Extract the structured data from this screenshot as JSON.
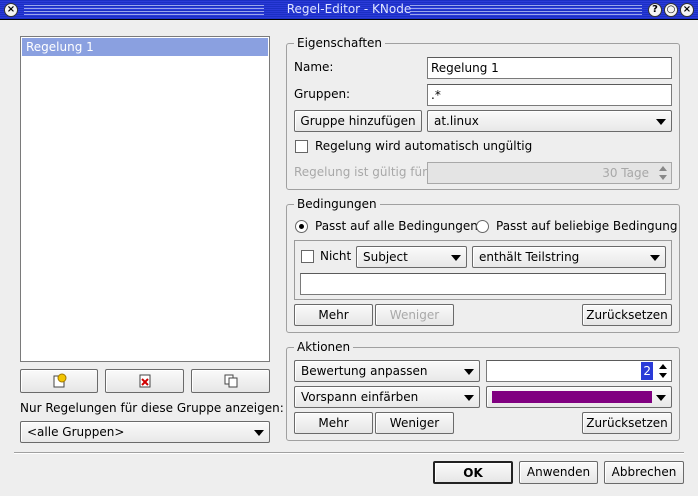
{
  "window": {
    "title": "Regel-Editor - KNode"
  },
  "rules_list": {
    "items": [
      "Regelung 1"
    ]
  },
  "list_buttons": {
    "new_icon": "new-rule-icon",
    "delete_icon": "delete-rule-icon",
    "copy_icon": "copy-rule-icon"
  },
  "group_filter": {
    "label": "Nur Regelungen für diese Gruppe anzeigen:",
    "value": "<alle Gruppen>"
  },
  "properties": {
    "title": "Eigenschaften",
    "name_label": "Name:",
    "name_value": "Regelung 1",
    "groups_label": "Gruppen:",
    "groups_value": ".*",
    "add_group_button": "Gruppe hinzufügen",
    "group_combo": "at.linux",
    "expires_checkbox_label": "Regelung wird automatisch ungültig",
    "valid_for_label": "Regelung ist gültig für:",
    "valid_for_value": "30 Tage"
  },
  "conditions": {
    "title": "Bedingungen",
    "radio_all": "Passt auf alle Bedingungen",
    "radio_any": "Passt auf beliebige Bedingung",
    "not_label": "Nicht",
    "field_combo": "Subject",
    "match_combo": "enthält Teilstring",
    "value": "",
    "more_button": "Mehr",
    "less_button": "Weniger",
    "reset_button": "Zurücksetzen"
  },
  "actions": {
    "title": "Aktionen",
    "action1_combo": "Bewertung anpassen",
    "action1_value": "2",
    "action2_combo": "Vorspann einfärben",
    "action2_color": "#800080",
    "more_button": "Mehr",
    "less_button": "Weniger",
    "reset_button": "Zurücksetzen"
  },
  "footer": {
    "ok_button": "OK",
    "apply_button": "Anwenden",
    "cancel_button": "Abbrechen"
  },
  "colors": {
    "titlebar": "#1b2fc4",
    "selection": "#8aa0e0",
    "swatch": "#800080"
  }
}
